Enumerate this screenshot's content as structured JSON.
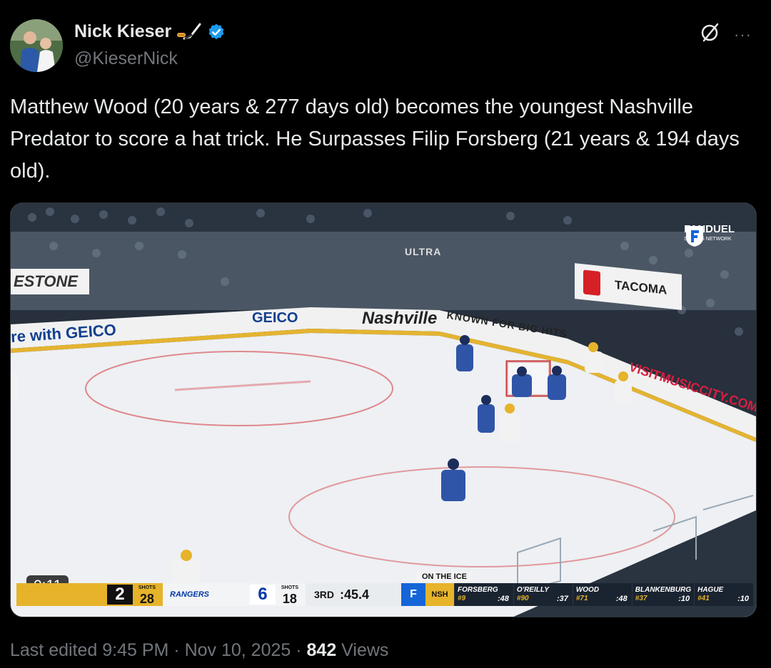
{
  "author": {
    "name": "Nick Kieser",
    "handle": "@KieserNick",
    "icons": [
      "hockey-stick-puck-icon",
      "verified-badge-icon"
    ]
  },
  "header_actions": {
    "grok_icon": "grok-slash-circle-icon",
    "more_icon": "more-options-icon",
    "more_glyph": "···"
  },
  "tweet": {
    "text": "Matthew Wood (20 years & 277 days old) becomes the youngest Nashville Predator to score a hat trick. He Surpasses Filip Forsberg (21 years & 194 days old)."
  },
  "video": {
    "timer": "0:11",
    "network": {
      "name": "FANDUEL",
      "sub": "SPORTS NETWORK"
    },
    "ads": {
      "firestone": "ESTONE",
      "tacoma": "TACOMA",
      "geico_left": "re with GEICO",
      "geico_mid": "GEICO",
      "nashville": "Nashville",
      "big_hits": "KNOWN FOR BIG HITS",
      "visit": "VISITMUSICCITY.COM",
      "ultra": "ULTRA"
    },
    "scorebug": {
      "away_score": "2",
      "away_shots_label": "SHOTS",
      "away_shots": "28",
      "home_team": "RANGERS",
      "home_score": "6",
      "home_shots_label": "SHOTS",
      "home_shots": "18",
      "period": "3RD",
      "clock": ":45.4",
      "on_ice_label": "ON THE ICE",
      "players": [
        {
          "name": "FORSBERG",
          "number": "#9",
          "time": ":48"
        },
        {
          "name": "O'REILLY",
          "number": "#90",
          "time": ":37"
        },
        {
          "name": "WOOD",
          "number": "#71",
          "time": ":48"
        },
        {
          "name": "BLANKENBURG",
          "number": "#37",
          "time": ":10"
        },
        {
          "name": "HAGUE",
          "number": "#41",
          "time": ":10"
        }
      ]
    }
  },
  "footer": {
    "edited": "Last edited 9:45 PM · Nov 10, 2025 · ",
    "views_count": "842",
    "views_label": " Views"
  },
  "colors": {
    "background": "#000000",
    "text": "#e7e9ea",
    "muted": "#71767b",
    "verified": "#1d9bf0",
    "predators_gold": "#e6b32a",
    "rangers_blue": "#0038a8"
  }
}
